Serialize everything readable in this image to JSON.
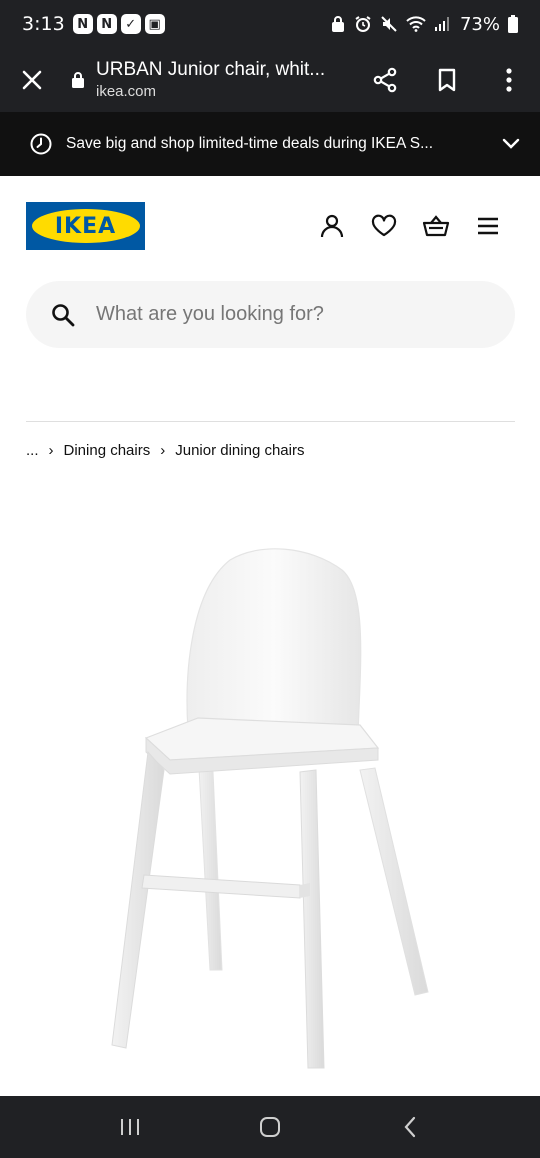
{
  "status_bar": {
    "time": "3:13",
    "notifications": [
      "N",
      "N",
      "✓",
      "▣"
    ],
    "battery": "73%"
  },
  "browser": {
    "page_title": "URBAN Junior chair, whit...",
    "domain": "ikea.com"
  },
  "promo_banner": {
    "text": "Save big and shop limited-time deals during IKEA S..."
  },
  "header": {
    "logo_text": "IKEA"
  },
  "search": {
    "placeholder": "What are you looking for?"
  },
  "breadcrumb": {
    "items": [
      "...",
      "Dining chairs",
      "Junior dining chairs"
    ]
  },
  "colors": {
    "ikea_blue": "#0058a3",
    "ikea_yellow": "#ffdb00",
    "system_bar": "#202124",
    "promo_bg": "#111111"
  }
}
